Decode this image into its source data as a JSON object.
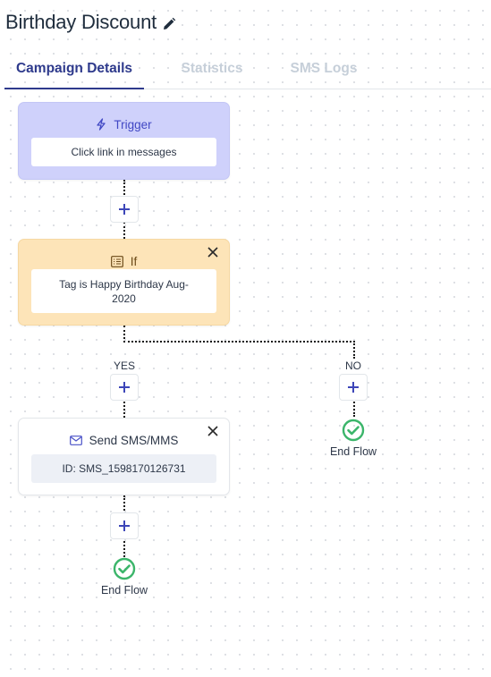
{
  "header": {
    "title": "Birthday Discount",
    "edit_icon": "pencil-icon"
  },
  "tabs": [
    {
      "label": "Campaign Details",
      "active": true
    },
    {
      "label": "Statistics",
      "active": false
    },
    {
      "label": "SMS Logs",
      "active": false
    }
  ],
  "flow": {
    "trigger": {
      "icon": "lightning-icon",
      "title": "Trigger",
      "body": "Click link in messages"
    },
    "condition": {
      "icon": "list-icon",
      "title": "If",
      "body": "Tag is Happy Birthday Aug-2020",
      "close_icon": "close-icon"
    },
    "branches": {
      "yes_label": "YES",
      "no_label": "NO"
    },
    "send_sms": {
      "icon": "envelope-icon",
      "title": "Send SMS/MMS",
      "body": "ID: SMS_1598170126731",
      "close_icon": "close-icon"
    },
    "add_step_icon": "plus-icon",
    "end_yes": {
      "icon": "check-circle-icon",
      "label": "End Flow"
    },
    "end_no": {
      "icon": "check-circle-icon",
      "label": "End Flow"
    }
  },
  "colors": {
    "accent": "#2e3a8c",
    "trigger_bg": "#cfd1fb",
    "condition_bg": "#fde4b8",
    "success": "#3bb56a"
  }
}
